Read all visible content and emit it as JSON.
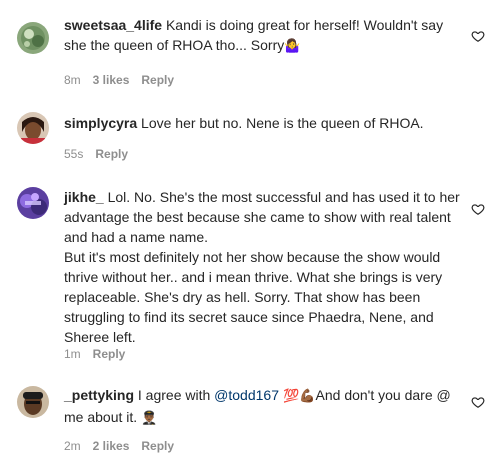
{
  "comments": [
    {
      "username": "sweetsaa_4life",
      "text": " Kandi is doing great for herself! Wouldn't say she the queen of RHOA tho... Sorry",
      "emoji": "🤷‍♀️",
      "time": "8m",
      "likes": "3 likes",
      "reply": "Reply"
    },
    {
      "username": "simplycyra",
      "text": " Love her but no. Nene is the queen of RHOA.",
      "time": "55s",
      "reply": "Reply"
    },
    {
      "username": "jikhe_",
      "text": " Lol. No. She's the most successful and has used it to her advantage the best because she came to show with real talent and had a name name.",
      "text2": "But it's most definitely not her show because the show would thrive without her.. and i mean thrive. What she brings is very replaceable. She's dry as hell. Sorry. That show has been struggling to find its secret sauce since Phaedra, Nene, and Sheree left.",
      "time": "1m",
      "reply": "Reply"
    },
    {
      "username": "_pettyking",
      "text": " I agree with ",
      "mention": "@todd167",
      "emoji1": " 💯💪🏾",
      "text_after": "And don't you dare @ me about it. ",
      "emoji2": "👨🏾‍✈️",
      "time": "2m",
      "likes": "2 likes",
      "reply": "Reply"
    }
  ],
  "icons": {
    "like": "heart-outline-icon"
  }
}
